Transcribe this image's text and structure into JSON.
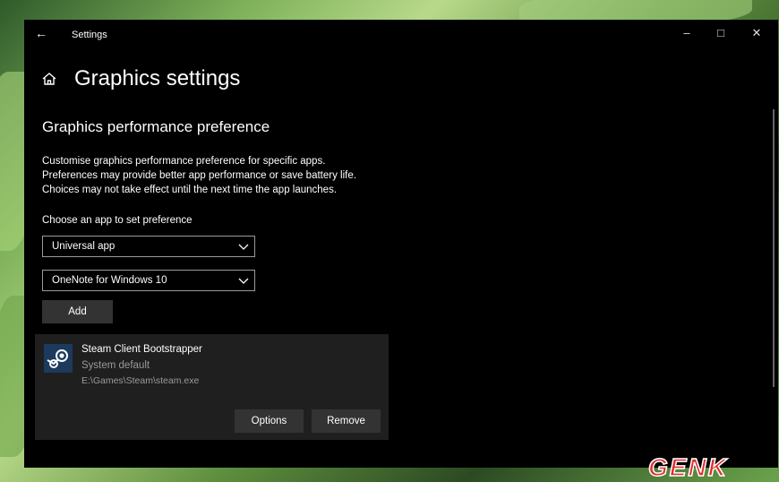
{
  "window": {
    "app_title": "Settings",
    "back_icon": "←",
    "minimize_icon": "–",
    "maximize_icon": "□",
    "close_icon": "✕"
  },
  "page": {
    "title": "Graphics settings",
    "section_title": "Graphics performance preference",
    "description_lines": [
      "Customise graphics performance preference for specific apps.",
      "Preferences may provide better app performance or save battery life.",
      "Choices may not take effect until the next time the app launches."
    ],
    "choose_label": "Choose an app to set preference",
    "app_type_select": {
      "value": "Universal app"
    },
    "app_select": {
      "value": "OneNote for Windows 10"
    },
    "add_label": "Add"
  },
  "app_list": [
    {
      "name": "Steam Client Bootstrapper",
      "preference": "System default",
      "path": "E:\\Games\\Steam\\steam.exe",
      "options_label": "Options",
      "remove_label": "Remove"
    }
  ],
  "watermark": "GENK",
  "colors": {
    "window_bg": "#000000",
    "card_bg": "#1f1f1f",
    "button_bg": "#333333",
    "muted_text": "#9a9a9a",
    "logo_red": "#e32b2b"
  }
}
